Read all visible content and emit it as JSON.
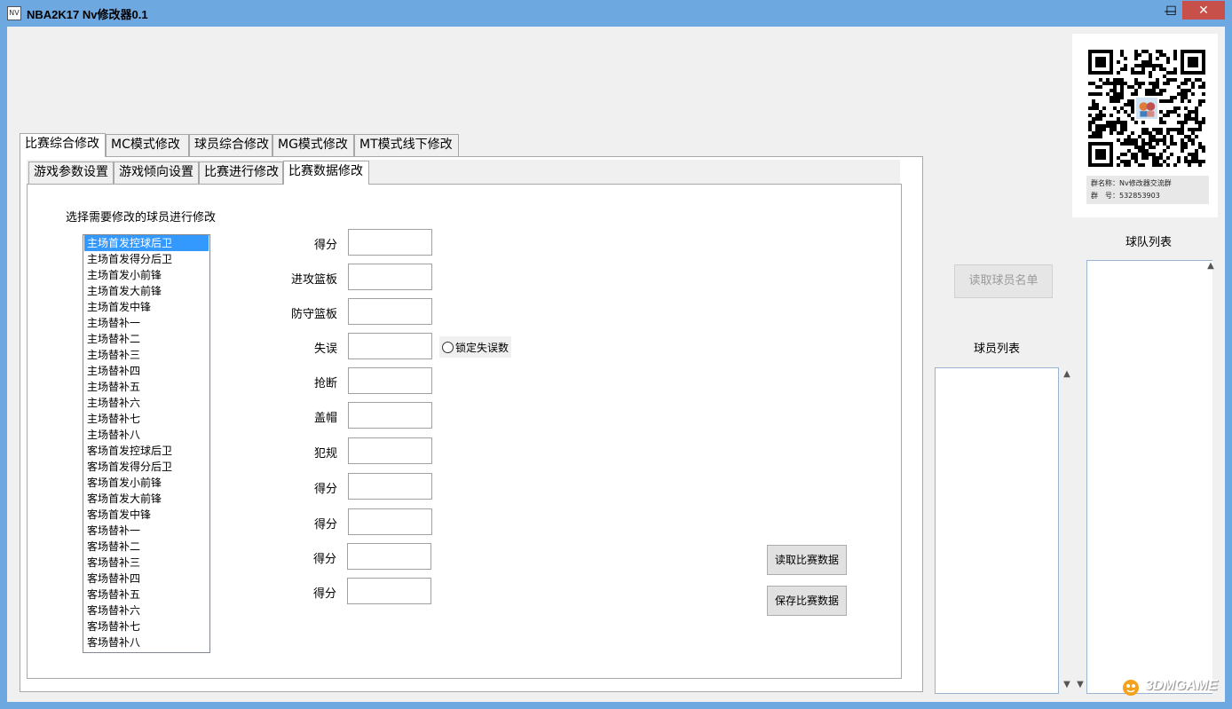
{
  "window": {
    "title": "NBA2K17 Nv修改器0.1",
    "icon_label": "NV",
    "minimize_glyph": "—",
    "maximize_glyph": "☐",
    "close_glyph": "✕"
  },
  "main_tabs": [
    {
      "label": "比赛综合修改",
      "active": true
    },
    {
      "label": "MC模式修改",
      "active": false
    },
    {
      "label": "球员综合修改",
      "active": false
    },
    {
      "label": "MG模式修改",
      "active": false
    },
    {
      "label": "MT模式线下修改",
      "active": false
    }
  ],
  "sub_tabs": [
    {
      "label": "游戏参数设置",
      "active": false
    },
    {
      "label": "游戏倾向设置",
      "active": false
    },
    {
      "label": "比赛进行修改",
      "active": false
    },
    {
      "label": "比赛数据修改",
      "active": true
    }
  ],
  "instruction": "选择需要修改的球员进行修改",
  "player_slots": [
    "主场首发控球后卫",
    "主场首发得分后卫",
    "主场首发小前锋",
    "主场首发大前锋",
    "主场首发中锋",
    "主场替补一",
    "主场替补二",
    "主场替补三",
    "主场替补四",
    "主场替补五",
    "主场替补六",
    "主场替补七",
    "主场替补八",
    "客场首发控球后卫",
    "客场首发得分后卫",
    "客场首发小前锋",
    "客场首发大前锋",
    "客场首发中锋",
    "客场替补一",
    "客场替补二",
    "客场替补三",
    "客场替补四",
    "客场替补五",
    "客场替补六",
    "客场替补七",
    "客场替补八"
  ],
  "selected_slot_index": 0,
  "fields": [
    {
      "label": "得分",
      "value": ""
    },
    {
      "label": "进攻篮板",
      "value": ""
    },
    {
      "label": "防守篮板",
      "value": ""
    },
    {
      "label": "失误",
      "value": ""
    },
    {
      "label": "抢断",
      "value": ""
    },
    {
      "label": "盖帽",
      "value": ""
    },
    {
      "label": "犯规",
      "value": ""
    },
    {
      "label": "得分",
      "value": ""
    },
    {
      "label": "得分",
      "value": ""
    },
    {
      "label": "得分",
      "value": ""
    },
    {
      "label": "得分",
      "value": ""
    }
  ],
  "lock_turnovers_label": "锁定失误数",
  "buttons": {
    "read_match_data": "读取比赛数据",
    "save_match_data": "保存比赛数据",
    "read_roster": "读取球员名单"
  },
  "qr": {
    "group_name_line": "群名称：Nv修改器交流群",
    "group_number_line": "群　号：532853903"
  },
  "labels": {
    "team_list": "球队列表",
    "player_list": "球员列表"
  },
  "scroll": {
    "up": "▲",
    "down": "▼"
  },
  "watermark": "3DMGAME"
}
